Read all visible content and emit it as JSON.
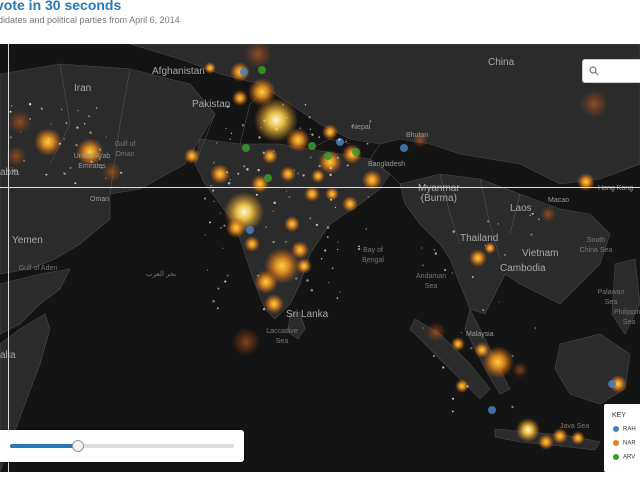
{
  "header": {
    "title": "vote in 30 seconds",
    "subtitle": "didates and political parties from April 6, 2014"
  },
  "map": {
    "country_labels": [
      "China",
      "Afghanistan",
      "Iran",
      "Pakistan",
      "Nepal",
      "Bhutan",
      "Bangladesh",
      "Myanmar\n(Burma)",
      "Laos",
      "Thailand",
      "Vietnam",
      "Cambodia",
      "Oman",
      "Yemen",
      "Sri Lanka",
      "Malaysia",
      "alia",
      "abia",
      "Macao",
      "Hong Kong",
      "United Arab Emirates"
    ],
    "water_labels": [
      "Gulf of Oman",
      "Gulf of Aden",
      "Bay of Bengal",
      "Andaman Sea",
      "South China Sea",
      "Laccadive Sea",
      "Java Sea",
      "Palawan Sea",
      "Philippine Sea"
    ],
    "script_labels": [
      "بحر العرب"
    ],
    "colors": {
      "background": "#141414",
      "land": "#2b2b2b",
      "border": "#555555",
      "party_a": "#4a7fc1",
      "party_b": "#e8821c",
      "party_c": "#3a9b2d"
    }
  },
  "search": {
    "icon": "search-icon"
  },
  "slider": {
    "progress": 0.3
  },
  "key": {
    "title": "KEY",
    "items": [
      {
        "label": "RAH",
        "color": "#4a7fc1"
      },
      {
        "label": "NAR",
        "color": "#e8821c"
      },
      {
        "label": "ARV",
        "color": "#3a9b2d"
      }
    ]
  }
}
